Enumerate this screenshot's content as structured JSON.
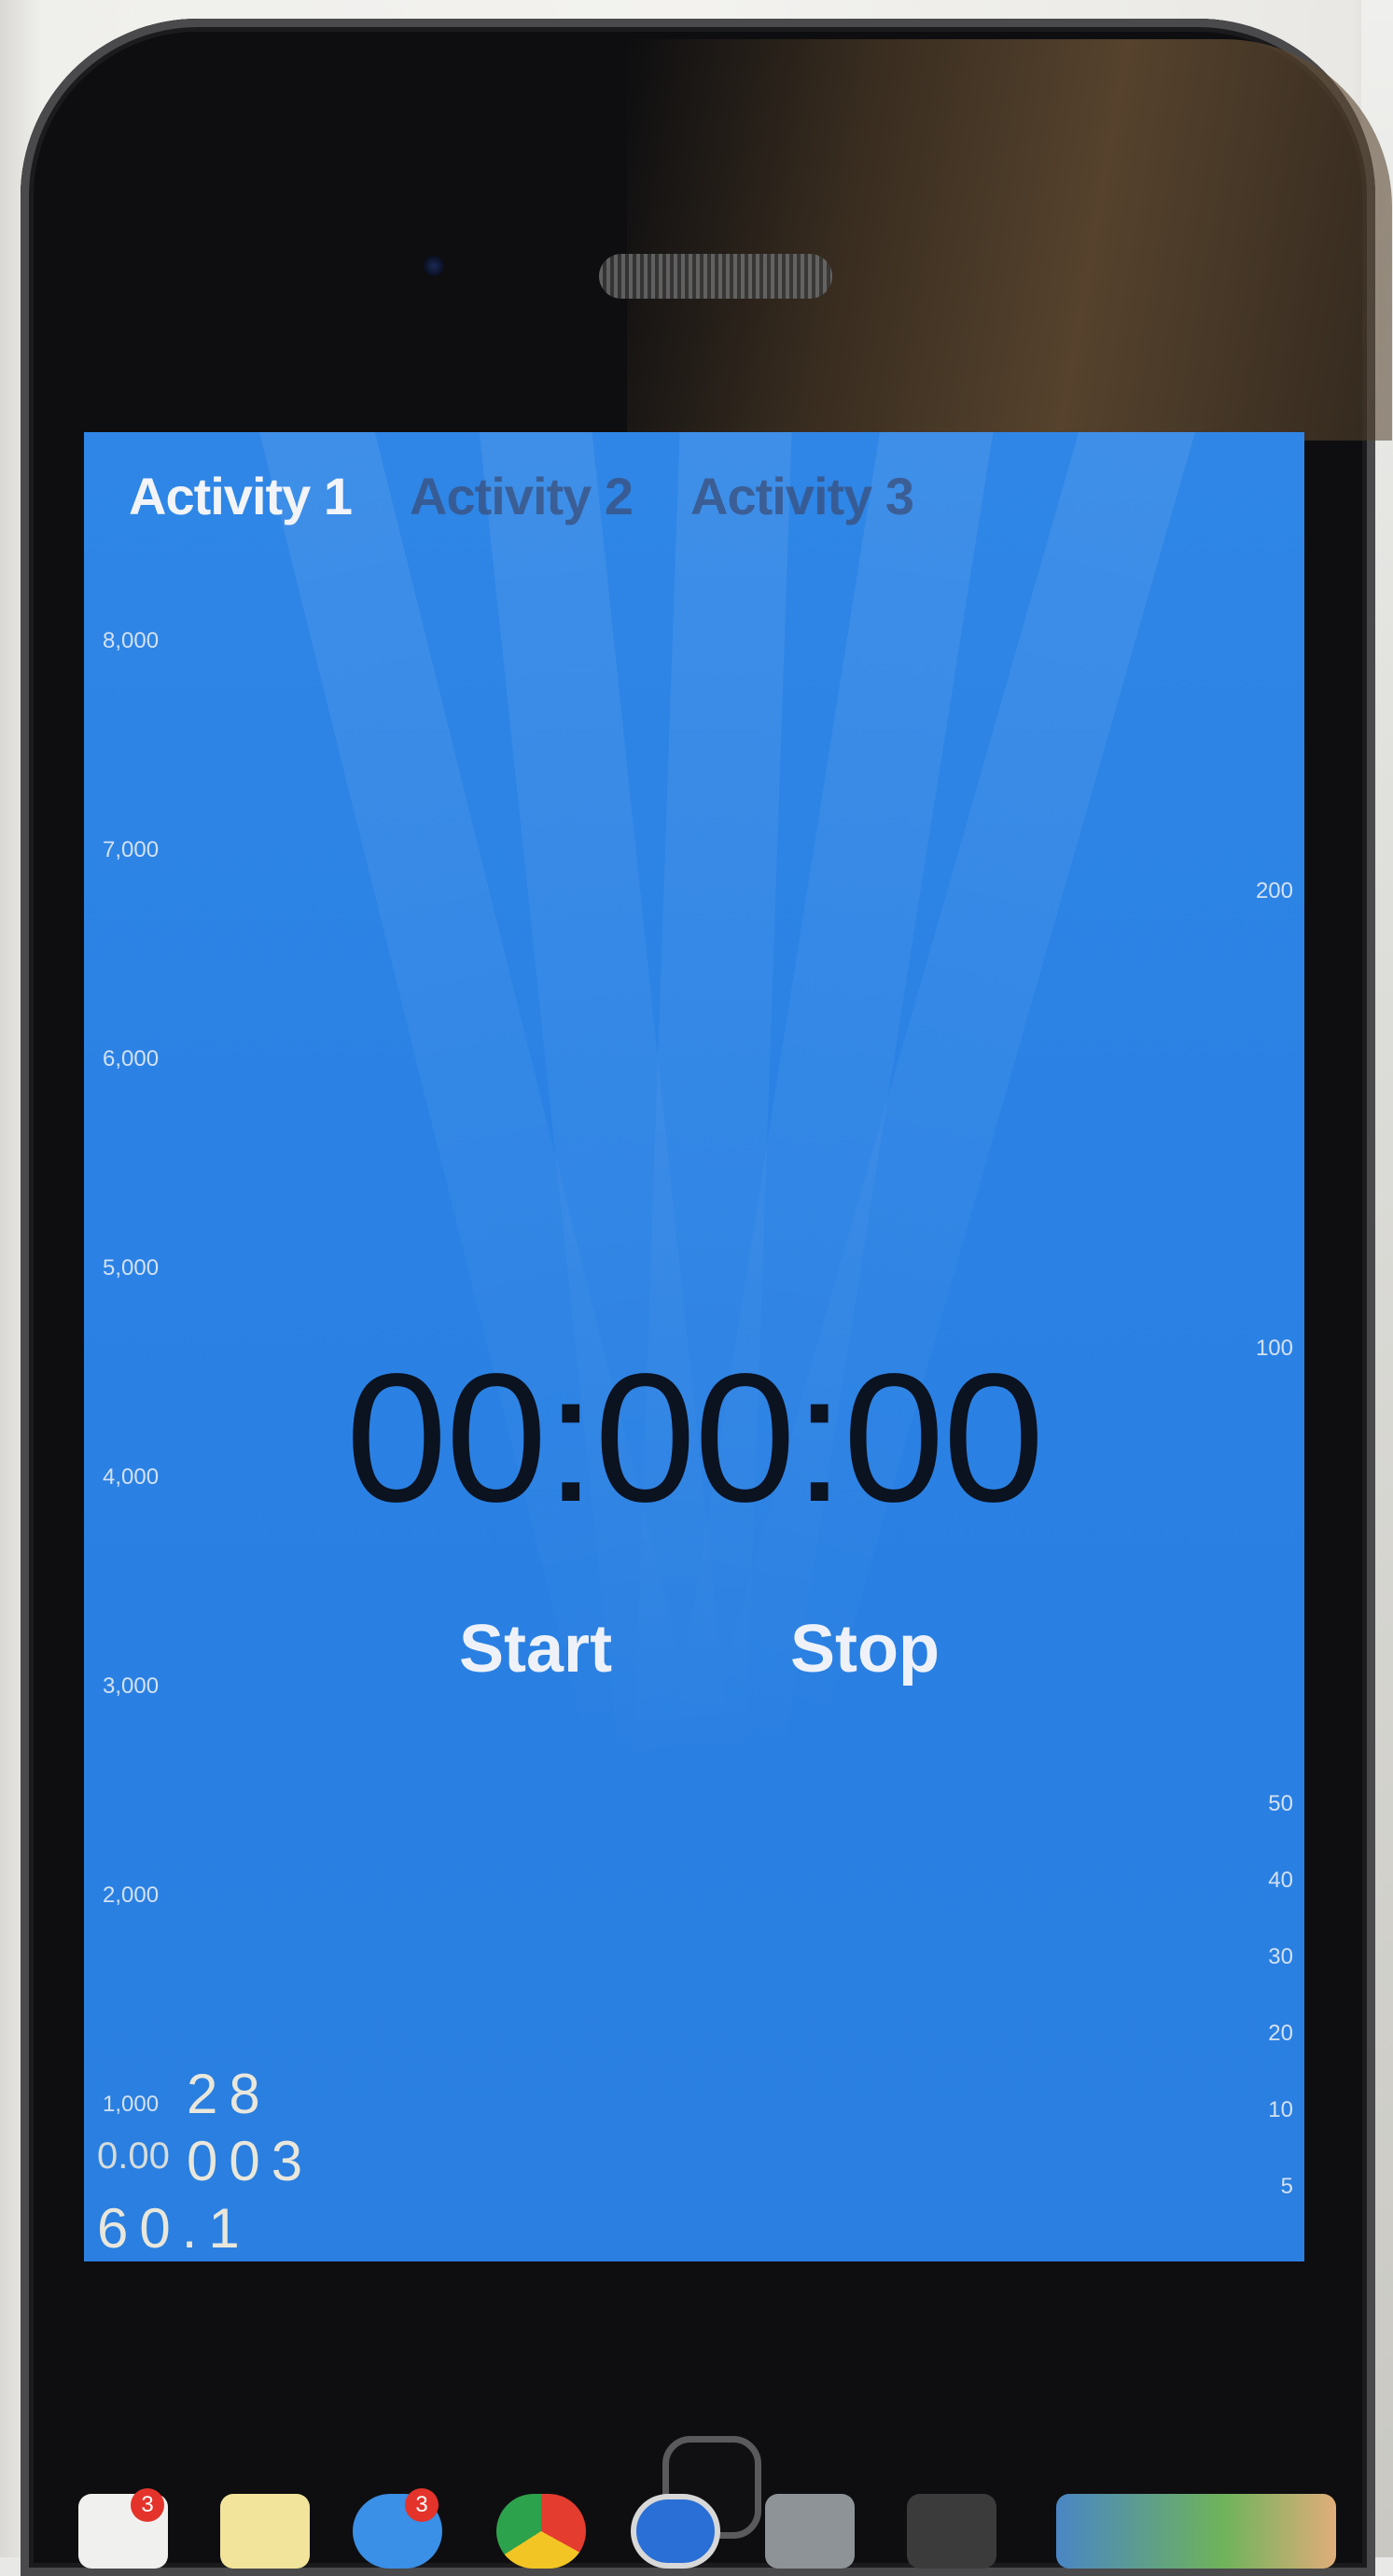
{
  "app": {
    "tabs": [
      {
        "label": "Activity 1",
        "active": true
      },
      {
        "label": "Activity 2",
        "active": false
      },
      {
        "label": "Activity 3",
        "active": false
      }
    ],
    "timer": "00:00:00",
    "start_label": "Start",
    "stop_label": "Stop",
    "left_axis_ticks": [
      "8,000",
      "7,000",
      "6,000",
      "5,000",
      "4,000",
      "3,000",
      "2,000",
      "1,000"
    ],
    "right_axis_ticks": [
      "200",
      "100",
      "50",
      "40",
      "30",
      "20",
      "10",
      "5"
    ],
    "stats": [
      "28",
      "003",
      "60.1"
    ],
    "stats_overlap_labels": [
      "0.00"
    ],
    "background_color": "#2b82e4",
    "timer_color": "#0b1220"
  },
  "dock": {
    "icons": [
      {
        "name": "reminders-icon",
        "badge": "3"
      },
      {
        "name": "notes-icon",
        "badge": ""
      },
      {
        "name": "messages-icon",
        "badge": "3"
      },
      {
        "name": "chrome-icon",
        "badge": ""
      },
      {
        "name": "itunes-icon",
        "badge": ""
      },
      {
        "name": "system-preferences-icon",
        "badge": ""
      },
      {
        "name": "sublime-text-icon",
        "badge": ""
      },
      {
        "name": "dock-misc-icon",
        "badge": ""
      }
    ]
  }
}
